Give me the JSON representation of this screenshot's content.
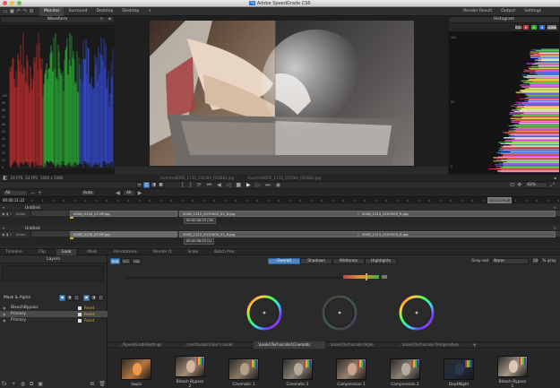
{
  "app": {
    "title": "Adobe SpeedGrade CS6",
    "logo_text": "Sg"
  },
  "menubar": {
    "left": [
      "Monitor",
      "Surround",
      "Desktop",
      "Desktop",
      "+"
    ],
    "right": [
      "Render Result",
      "Output",
      "Settings"
    ],
    "active_index": 0
  },
  "waveform": {
    "title": "Waveform",
    "scale": [
      "100",
      "90",
      "80",
      "70",
      "60",
      "50",
      "40",
      "30",
      "20",
      "10",
      "0"
    ]
  },
  "histogram": {
    "title": "Histogram",
    "channels": [
      "RGB",
      "R",
      "G",
      "B",
      "LUMA"
    ],
    "scale": [
      "100",
      "50",
      "0"
    ]
  },
  "viewer": {
    "status_left": [
      "24 FPS",
      "24 FPS",
      "1920 x 1080"
    ],
    "file_left": "OvertenBORE_1733_15038A_R03883.jpg",
    "file_right": "OvertenBORE_1733_15038A_R03883.jpg",
    "zoom": "42%"
  },
  "timeline": {
    "timecode": "00:00:11:22",
    "playhead_tc": "00:02:29:08",
    "all_label": "All",
    "auto_label": "Auto",
    "tracks": [
      {
        "name": "Untitled",
        "label": "Video",
        "clips": [
          "0008_0130_07.BP.jpg",
          "0008_1312_0370005_02_R.jpg",
          "0008_1313_0103303_R.jpg"
        ],
        "tc": "00:00:06:25 (30)"
      },
      {
        "name": "Untitled",
        "label": "Video",
        "clips": [
          "0008_0130_07.BP.jpg",
          "0008_1312_0370005_02_R.jpg",
          "0008_1313_0103303_R.jpg"
        ],
        "tc": "00:00:06:25 (1)"
      }
    ]
  },
  "bottom": {
    "tabs": [
      "Timeline",
      "Clip",
      "Look",
      "Mask",
      "Annotations",
      "Render Q",
      "Scale",
      "Batch Proc"
    ],
    "active_tab": 2,
    "layers_title": "Layers",
    "mask_label": "Mask & Alpha",
    "layers": [
      {
        "name": "BleachBypass",
        "flag": "Reset"
      },
      {
        "name": "Primary",
        "flag": "Reset"
      },
      {
        "name": "Primary",
        "flag": "Reset"
      }
    ],
    "selected_layer": 1,
    "mode_buttons": [
      "Overall",
      "Shadows",
      "Midtones",
      "Highlights"
    ],
    "active_mode": 0,
    "gray_out_label": "Gray-out",
    "gray_out_value": "None",
    "percent_gray": "50",
    "percent_gray_label": "% gray",
    "small_buttons": [
      "RGB",
      "YCC",
      "HSL"
    ],
    "look_tabs": [
      "../SpeedGrade\\Settings",
      "..ccent\\Looks\\Color's Looks",
      "..\\Looks\\Technicolor\\Cinematic",
      "..\\Looks\\Technicolor\\Style",
      "..\\Looks\\Technicolor\\Temperature"
    ],
    "active_look_tab": 2,
    "looks": [
      "Sepia",
      "Bleach Bypass 2",
      "Cinematic 1",
      "Cinematic 2",
      "Compression 1",
      "Compression 2",
      "Day4Night",
      "Bleach Bypass 1"
    ]
  },
  "colors": {
    "accent": "#4d88c4",
    "panel_bg": "#262626"
  }
}
